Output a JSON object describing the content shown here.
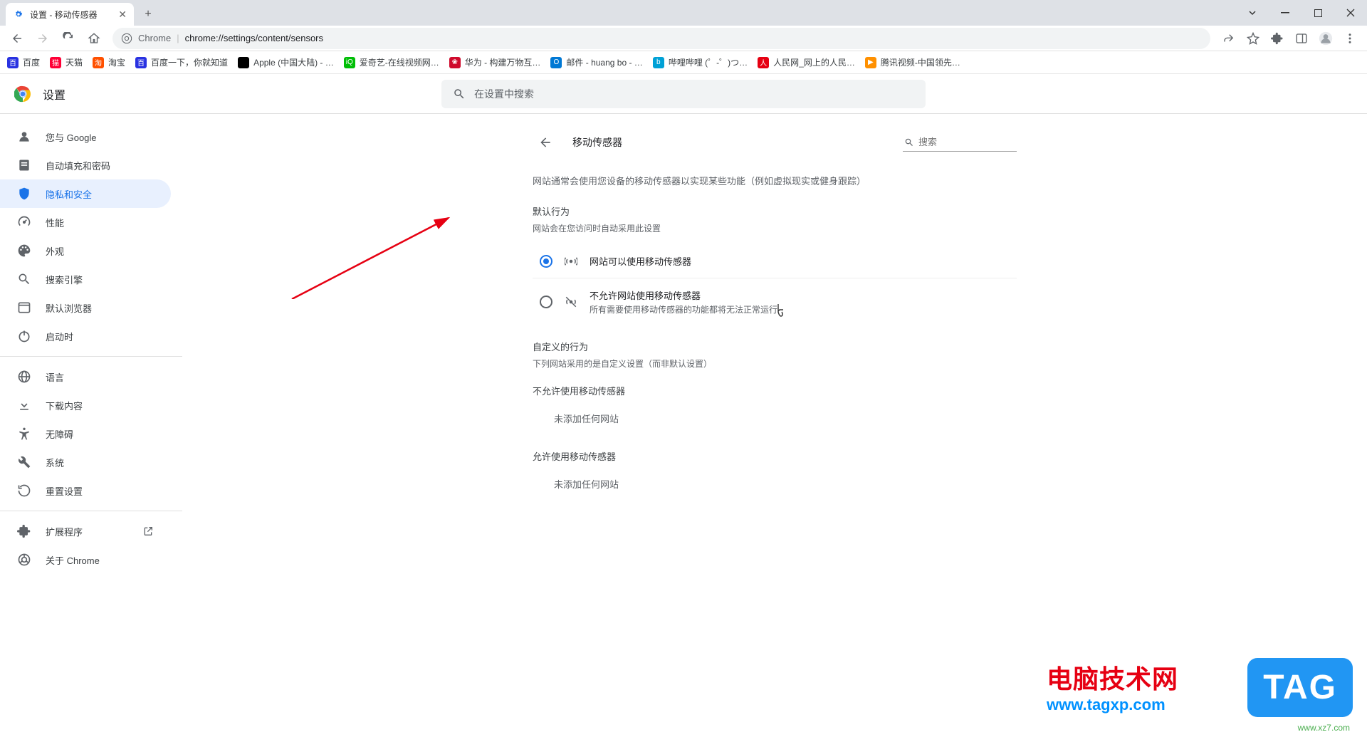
{
  "tab": {
    "title": "设置 - 移动传感器"
  },
  "url": {
    "host": "Chrome",
    "path": "chrome://settings/content/sensors"
  },
  "bookmarks": [
    {
      "label": "百度",
      "icon_bg": "#2932e1",
      "glyph": "百"
    },
    {
      "label": "天猫",
      "icon_bg": "#ff0036",
      "glyph": "猫"
    },
    {
      "label": "淘宝",
      "icon_bg": "#ff5000",
      "glyph": "淘"
    },
    {
      "label": "百度一下，你就知道",
      "icon_bg": "#2932e1",
      "glyph": "百"
    },
    {
      "label": "Apple (中国大陆) - …",
      "icon_bg": "#000",
      "glyph": ""
    },
    {
      "label": "爱奇艺-在线视频网…",
      "icon_bg": "#00be06",
      "glyph": "iQ"
    },
    {
      "label": "华为 - 构建万物互…",
      "icon_bg": "#cf0a2c",
      "glyph": "❀"
    },
    {
      "label": "邮件 - huang bo - …",
      "icon_bg": "#0078d4",
      "glyph": "O"
    },
    {
      "label": "哔哩哔哩 (゜-゜)つ…",
      "icon_bg": "#00a1d6",
      "glyph": "b"
    },
    {
      "label": "人民网_网上的人民…",
      "icon_bg": "#e60012",
      "glyph": "人"
    },
    {
      "label": "腾讯视频-中国领先…",
      "icon_bg": "#ff9000",
      "glyph": "▶"
    }
  ],
  "settings": {
    "title": "设置",
    "search_placeholder": "在设置中搜索",
    "nav": [
      {
        "label": "您与 Google",
        "icon": "person"
      },
      {
        "label": "自动填充和密码",
        "icon": "form"
      },
      {
        "label": "隐私和安全",
        "icon": "shield",
        "active": true
      },
      {
        "label": "性能",
        "icon": "speed"
      },
      {
        "label": "外观",
        "icon": "palette"
      },
      {
        "label": "搜索引擎",
        "icon": "search"
      },
      {
        "label": "默认浏览器",
        "icon": "browser"
      },
      {
        "label": "启动时",
        "icon": "power"
      }
    ],
    "nav2": [
      {
        "label": "语言",
        "icon": "globe"
      },
      {
        "label": "下载内容",
        "icon": "download"
      },
      {
        "label": "无障碍",
        "icon": "accessibility"
      },
      {
        "label": "系统",
        "icon": "wrench"
      },
      {
        "label": "重置设置",
        "icon": "restore"
      }
    ],
    "nav3": [
      {
        "label": "扩展程序",
        "icon": "extension",
        "external": true
      },
      {
        "label": "关于 Chrome",
        "icon": "chrome"
      }
    ]
  },
  "panel": {
    "title": "移动传感器",
    "search_placeholder": "搜索",
    "description": "网站通常会使用您设备的移动传感器以实现某些功能（例如虚拟现实或健身跟踪）",
    "default_title": "默认行为",
    "default_sub": "网站会在您访问时自动采用此设置",
    "option1": "网站可以使用移动传感器",
    "option2": "不允许网站使用移动传感器",
    "option2_sub": "所有需要使用移动传感器的功能都将无法正常运行",
    "custom_title": "自定义的行为",
    "custom_sub": "下列网站采用的是自定义设置（而非默认设置）",
    "block_title": "不允许使用移动传感器",
    "empty": "未添加任何网站",
    "allow_title": "允许使用移动传感器"
  },
  "watermark": {
    "line1": "电脑技术网",
    "line2": "www.tagxp.com",
    "tag": "TAG",
    "small": "www.xz7.com"
  }
}
